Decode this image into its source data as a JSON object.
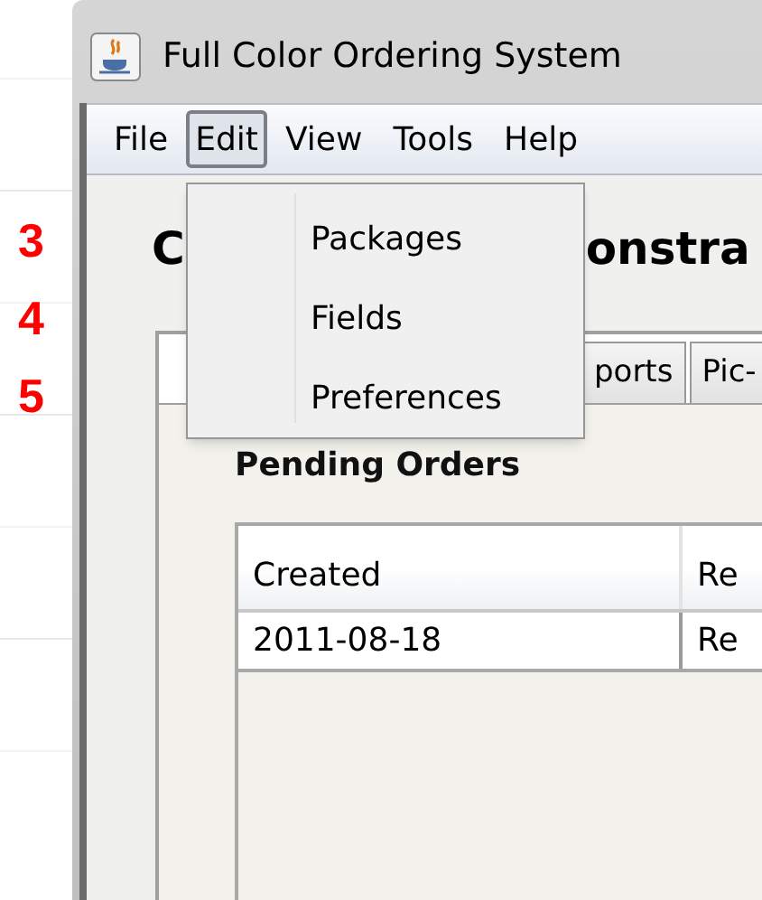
{
  "window": {
    "title": "Full Color Ordering System"
  },
  "menu_bar": [
    {
      "label": "File",
      "selected": false
    },
    {
      "label": "Edit",
      "selected": true
    },
    {
      "label": "View",
      "selected": false
    },
    {
      "label": "Tools",
      "selected": false
    },
    {
      "label": "Help",
      "selected": false
    }
  ],
  "edit_menu": {
    "items": [
      "Packages",
      "Fields",
      "Preferences"
    ]
  },
  "annotations": [
    "3",
    "4",
    "5"
  ],
  "heading": {
    "visible_start": "C",
    "visible_end": "onstra"
  },
  "tabs": [
    {
      "label": "ports",
      "selected": false
    },
    {
      "label": "Pic-",
      "selected": false
    }
  ],
  "section_title": "Pending Orders",
  "table": {
    "columns": [
      "Created",
      "Re"
    ],
    "rows": [
      [
        "2011-08-18",
        "Re"
      ]
    ]
  }
}
